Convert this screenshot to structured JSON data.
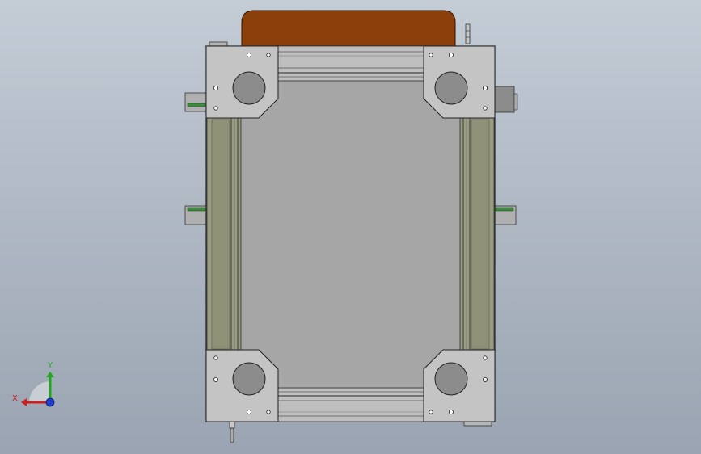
{
  "viewport": {
    "background_top": "#c4ccd6",
    "background_bottom": "#9aa4b2"
  },
  "model": {
    "plate_color": "#a6a6a6",
    "frame_color": "#bdbdbd",
    "rail_color": "#9a9c82",
    "cover_color": "#8b3f0a",
    "motor_color": "#8c8c8c",
    "connector_color": "#3c8a3c"
  },
  "triad": {
    "x_label": "X",
    "y_label": "Y",
    "x_color": "#cc1f1f",
    "y_color": "#22a622",
    "z_color": "#1f3fcc"
  }
}
